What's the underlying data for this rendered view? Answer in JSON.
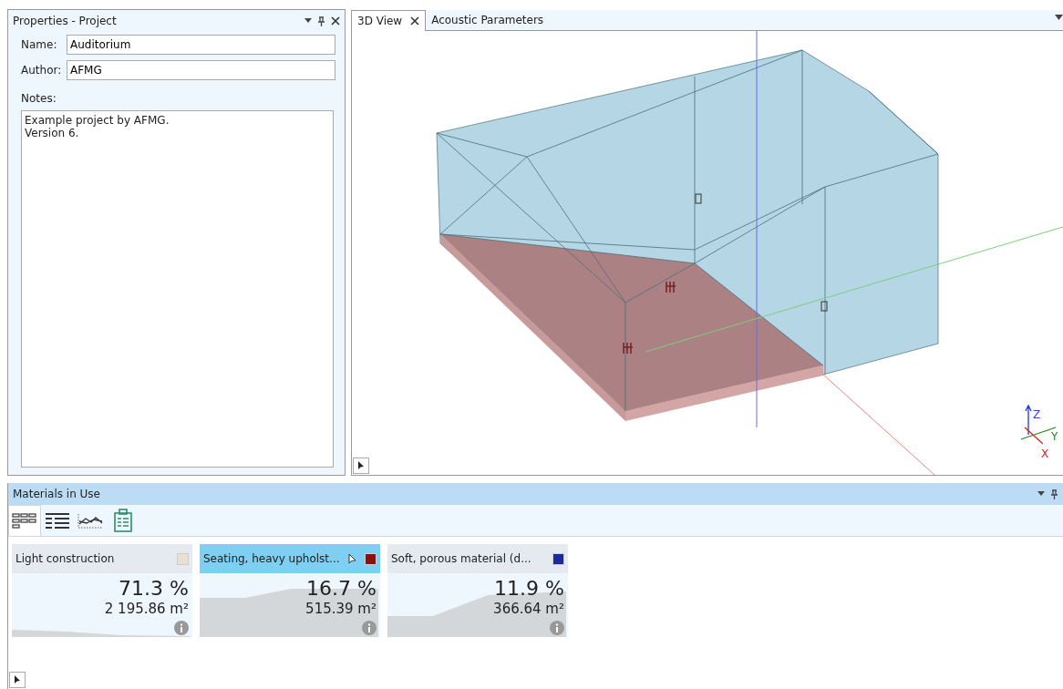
{
  "properties_panel": {
    "title": "Properties - Project",
    "fields": [
      {
        "label": "Name:",
        "value": "Auditorium"
      },
      {
        "label": "Author:",
        "value": "AFMG"
      }
    ],
    "notes_label": "Notes:",
    "notes": "Example project by AFMG.\nVersion 6."
  },
  "tabs": [
    {
      "label": "3D View",
      "selected": true,
      "closable": true
    },
    {
      "label": "Acoustic Parameters",
      "selected": false,
      "closable": false
    }
  ],
  "view_axes": {
    "z": "Z",
    "y": "Y",
    "x": "X"
  },
  "materials_panel": {
    "title": "Materials in Use",
    "view_modes": [
      {
        "kind": "tiles",
        "selected": true
      },
      {
        "kind": "list",
        "selected": false
      },
      {
        "kind": "graph",
        "selected": false
      },
      {
        "kind": "report",
        "selected": false
      }
    ],
    "materials": [
      {
        "name": "Light construction",
        "color": "#e8e0d0",
        "percent": "71.3 %",
        "area": "2 195.86 m²",
        "selected": false
      },
      {
        "name": "Seating, heavy upholst...",
        "color": "#8b1010",
        "percent": "16.7 %",
        "area": "515.39 m²",
        "selected": true
      },
      {
        "name": "Soft, porous material (d...",
        "color": "#1e2a9a",
        "percent": "11.9 %",
        "area": "366.64 m²",
        "selected": false
      }
    ]
  }
}
